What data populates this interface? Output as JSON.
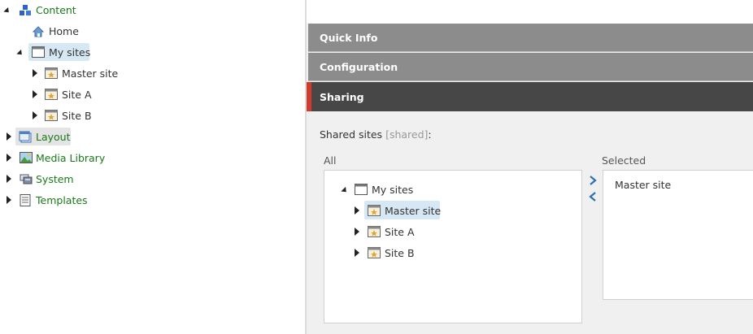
{
  "tree": {
    "content": "Content",
    "home": "Home",
    "my_sites": "My sites",
    "master_site": "Master site",
    "site_a": "Site A",
    "site_b": "Site B",
    "layout": "Layout",
    "media_library": "Media Library",
    "system": "System",
    "templates": "Templates"
  },
  "sections": {
    "quick_info": "Quick Info",
    "configuration": "Configuration",
    "sharing": "Sharing"
  },
  "sharing": {
    "field_label": "Shared sites",
    "field_key": "[shared]",
    "colon": ":",
    "all_label": "All",
    "selected_label": "Selected",
    "all_tree": {
      "my_sites": "My sites",
      "master_site": "Master site",
      "site_a": "Site A",
      "site_b": "Site B"
    },
    "selected_items": [
      "Master site"
    ]
  },
  "colors": {
    "tree_link": "#1a7a1a",
    "selected_bg": "#d7e8f5",
    "bar_light": "#8c8c8c",
    "bar_dark": "#474747",
    "accent": "#d33a2c",
    "move_arrow": "#2f6fb4"
  },
  "icons": {
    "content": "content-cubes-icon",
    "home": "home-icon",
    "my_sites": "window-icon",
    "site": "site-star-icon",
    "layout": "layout-icon",
    "media_library": "media-image-icon",
    "system": "system-icon",
    "templates": "templates-icon",
    "add": "move-right-icon",
    "remove": "move-left-icon"
  }
}
